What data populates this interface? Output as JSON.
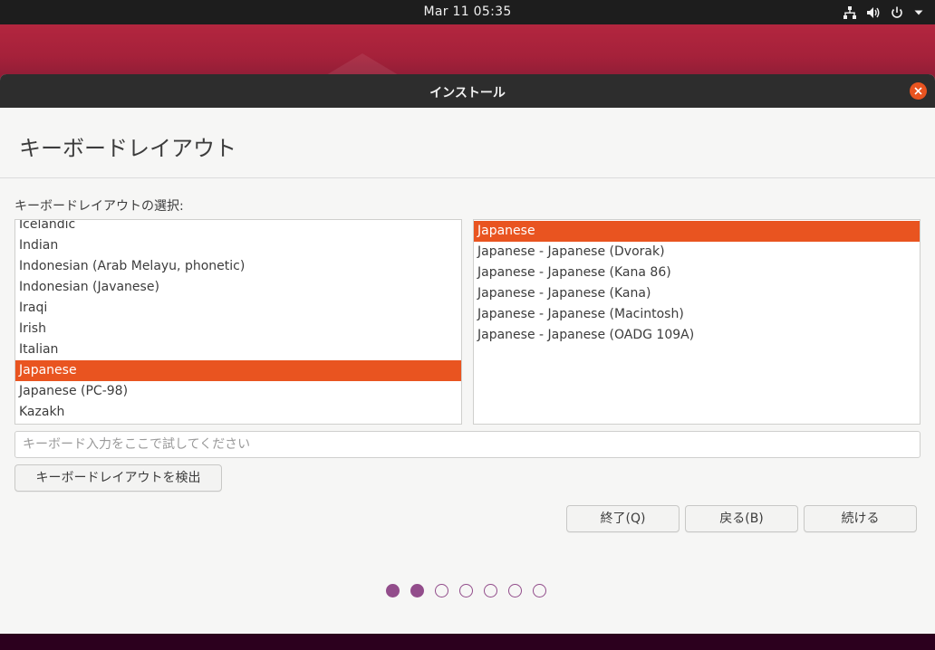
{
  "topbar": {
    "clock": "Mar 11  05:35",
    "icons": [
      "network-icon",
      "volume-icon",
      "power-icon",
      "chevron-down-icon"
    ]
  },
  "window": {
    "title": "インストール",
    "heading": "キーボードレイアウト",
    "select_label": "キーボードレイアウトの選択:"
  },
  "layouts": [
    {
      "label": "Icelandic",
      "selected": false
    },
    {
      "label": "Indian",
      "selected": false
    },
    {
      "label": "Indonesian (Arab Melayu, phonetic)",
      "selected": false
    },
    {
      "label": "Indonesian (Javanese)",
      "selected": false
    },
    {
      "label": "Iraqi",
      "selected": false
    },
    {
      "label": "Irish",
      "selected": false
    },
    {
      "label": "Italian",
      "selected": false
    },
    {
      "label": "Japanese",
      "selected": true
    },
    {
      "label": "Japanese (PC-98)",
      "selected": false
    },
    {
      "label": "Kazakh",
      "selected": false
    }
  ],
  "variants": [
    {
      "label": "Japanese",
      "selected": true
    },
    {
      "label": "Japanese - Japanese (Dvorak)",
      "selected": false
    },
    {
      "label": "Japanese - Japanese (Kana 86)",
      "selected": false
    },
    {
      "label": "Japanese - Japanese (Kana)",
      "selected": false
    },
    {
      "label": "Japanese - Japanese (Macintosh)",
      "selected": false
    },
    {
      "label": "Japanese - Japanese (OADG 109A)",
      "selected": false
    }
  ],
  "test_input": {
    "placeholder": "キーボード入力をここで試してください",
    "value": ""
  },
  "buttons": {
    "detect": "キーボードレイアウトを検出",
    "quit": "終了(Q)",
    "back": "戻る(B)",
    "continue": "続ける"
  },
  "progress": {
    "total_steps": 7,
    "current_step": 2
  },
  "colors": {
    "accent": "#e95420",
    "progress_dot": "#924d8b",
    "titlebar": "#2d2d2d"
  }
}
